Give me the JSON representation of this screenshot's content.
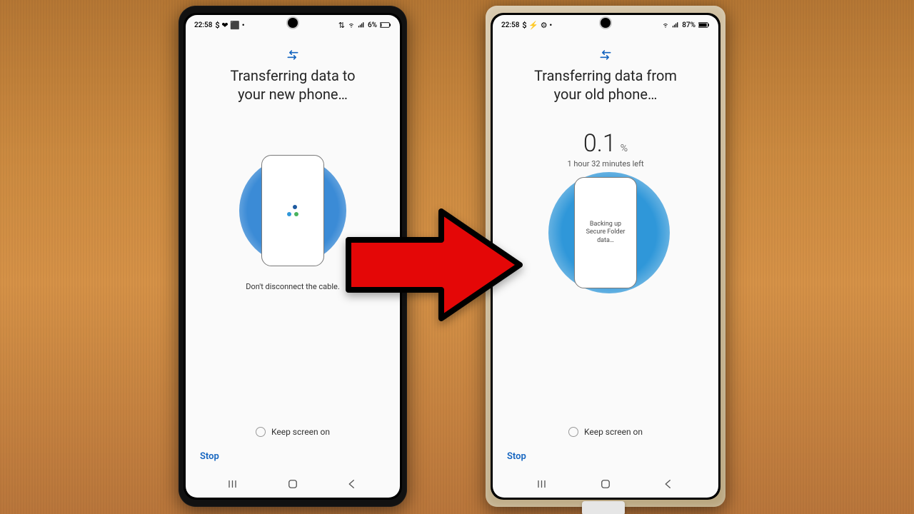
{
  "left_phone": {
    "status": {
      "time": "22:58",
      "left_glyphs": "$ ❤ ⬛ •",
      "right_glyphs": "⇅",
      "battery_text": "6%"
    },
    "title": "Transferring data to\nyour new phone…",
    "hint": "Don't disconnect the cable.",
    "keep_screen_label": "Keep screen on",
    "stop_label": "Stop"
  },
  "right_phone": {
    "status": {
      "time": "22:58",
      "left_glyphs": "$ ⚡ ⚙ •",
      "right_glyphs": "",
      "battery_text": "87%"
    },
    "title": "Transferring data from\nyour old phone…",
    "progress_value": "0.1",
    "progress_unit": "%",
    "eta": "1 hour 32 minutes left",
    "mini_status": "Backing up\nSecure Folder\ndata…",
    "keep_screen_label": "Keep screen on",
    "stop_label": "Stop"
  }
}
